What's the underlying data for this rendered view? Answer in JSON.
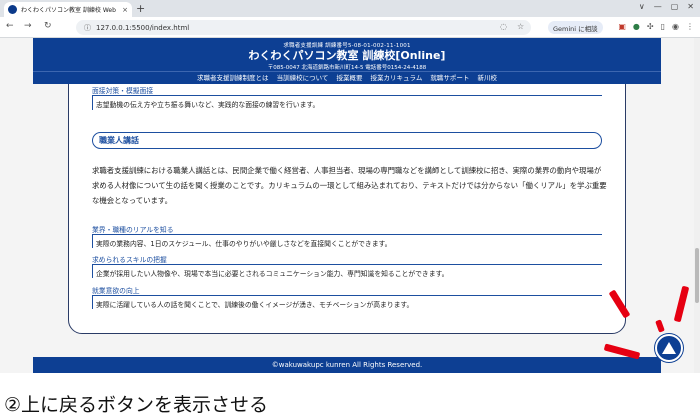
{
  "browser": {
    "tab_title": "わくわくパソコン教室 訓練校 Web",
    "tab_close": "×",
    "new_tab": "+",
    "url": "127.0.0.1:5500/index.html",
    "gemini_label": "Gemini に相談",
    "window_controls": [
      "∨",
      "—",
      "▢",
      "✕"
    ]
  },
  "site": {
    "sub_title": "求職者支援訓練 訓練番号5-08-01-002-11-1001",
    "name": "わくわくパソコン教室 訓練校[Online]",
    "address": "〒085-0047 北海道釧路市新川町14-5 電話番号0154-24-4188",
    "nav": [
      "求職者支援訓練制度とは",
      "当訓練校について",
      "授業概要",
      "授業カリキュラム",
      "就職サポート",
      "新川校"
    ],
    "footer": "©wakuwakupc kunren All Rights Reserved."
  },
  "content": {
    "interview": {
      "heading": "面接対策・模擬面接",
      "body": "志望動機の伝え方や立ち振る舞いなど、実践的な面接の練習を行います。"
    },
    "lecture": {
      "title": "職業人講話",
      "paragraph": "求職者支援訓練における職業人講話とは、民間企業で働く経営者、人事担当者、現場の専門職などを講師として訓練校に招き、実際の業界の動向や現場が求める人材像について生の話を聞く授業のことです。カリキュラムの一環として組み込まれており、テキストだけでは分からない「働くリアル」を学ぶ重要な機会となっています。",
      "items": [
        {
          "heading": "業界・職種のリアルを知る",
          "body": "実際の業務内容、1日のスケジュール、仕事のやりがいや厳しさなどを直接聞くことができます。"
        },
        {
          "heading": "求められるスキルの把握",
          "body": "企業が採用したい人物像や、現場で本当に必要とされるコミュニケーション能力、専門知識を知ることができます。"
        },
        {
          "heading": "就業意欲の向上",
          "body": "実際に活躍している人の話を聞くことで、訓練後の働くイメージが湧き、モチベーションが高まります。"
        }
      ]
    }
  },
  "caption": "②上に戻るボタンを表示させる",
  "colors": {
    "brand": "#0d3f93",
    "accent": "#1d4fa0",
    "emphasis": "#e60012"
  }
}
